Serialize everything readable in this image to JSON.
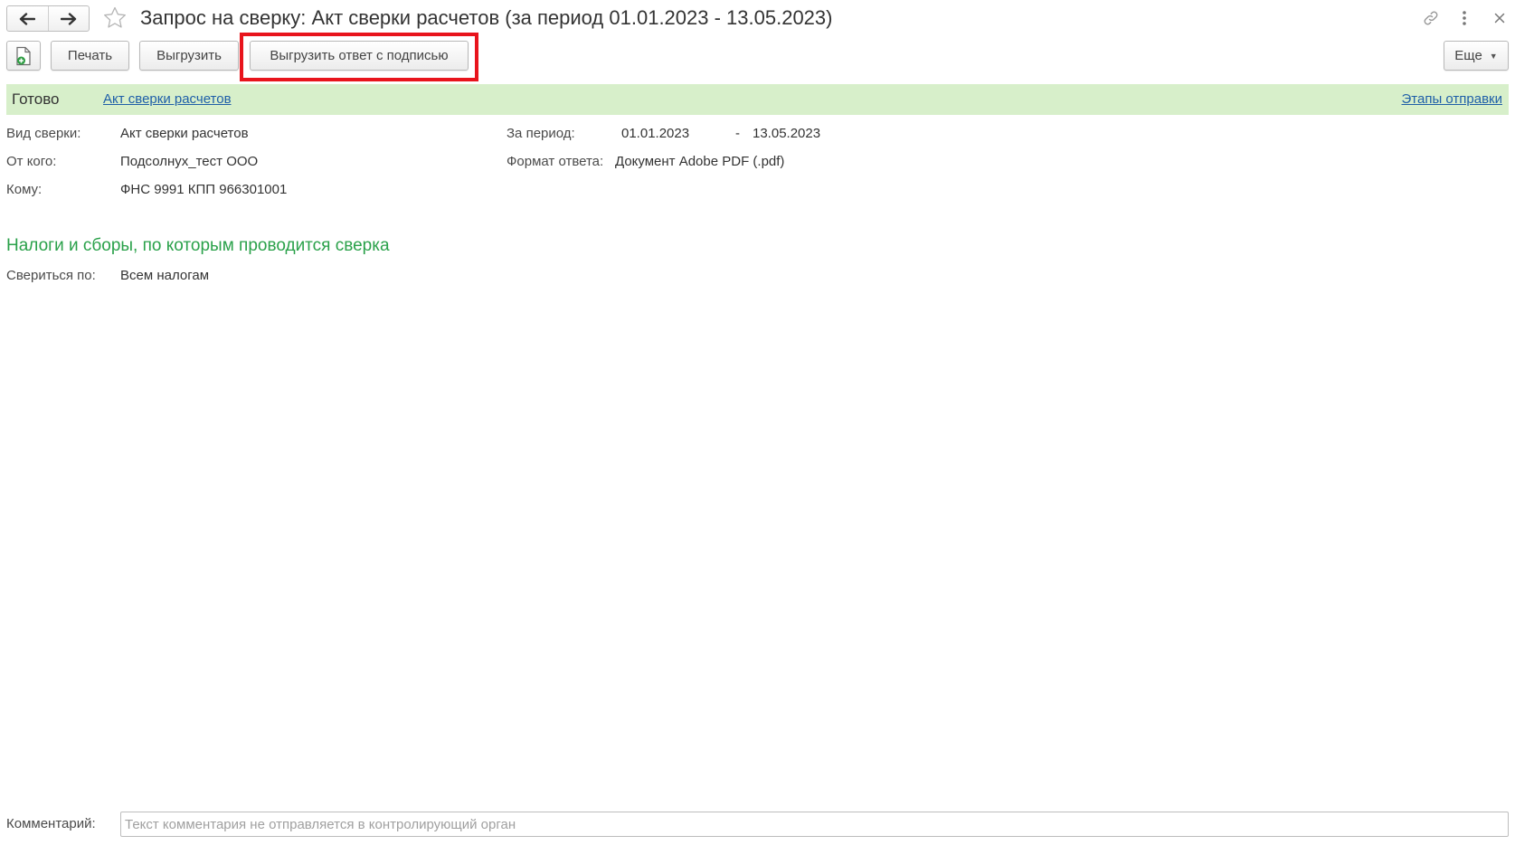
{
  "window": {
    "title": "Запрос на сверку: Акт сверки расчетов (за период 01.01.2023 - 13.05.2023)"
  },
  "toolbar": {
    "print_label": "Печать",
    "export_label": "Выгрузить",
    "export_signed_label": "Выгрузить ответ с подписью",
    "more_label": "Еще"
  },
  "status": {
    "text": "Готово",
    "doc_link": "Акт сверки расчетов",
    "stages_link": "Этапы отправки",
    "bg_color": "#d7efca"
  },
  "fields": {
    "type_label": "Вид сверки:",
    "type_value": "Акт сверки расчетов",
    "from_label": "От кого:",
    "from_value": "Подсолнух_тест ООО",
    "to_label": "Кому:",
    "to_value": "ФНС 9991 КПП 966301001",
    "period_label": "За период:",
    "period_from": "01.01.2023",
    "period_sep": "-",
    "period_to": "13.05.2023",
    "format_label": "Формат ответа:",
    "format_value": "Документ Adobe PDF (.pdf)"
  },
  "taxes": {
    "section_title": "Налоги и сборы, по которым проводится сверка",
    "check_label": "Свериться по:",
    "check_value": "Всем налогам"
  },
  "comment": {
    "label": "Комментарий:",
    "value": "",
    "placeholder": "Текст комментария не отправляется в контролирующий орган"
  },
  "colors": {
    "accent_green": "#2aa14a",
    "link_blue": "#1f5fa8",
    "highlight_red": "#e8141c"
  }
}
